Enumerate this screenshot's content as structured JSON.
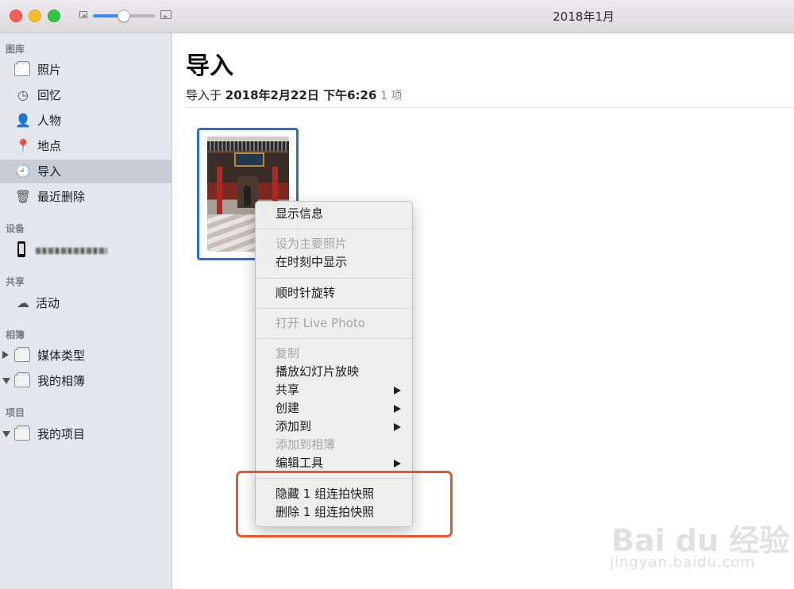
{
  "window": {
    "title": "2018年1月"
  },
  "sidebar": {
    "sections": {
      "library": "图库",
      "devices": "设备",
      "shared": "共享",
      "albums": "相簿",
      "projects": "项目"
    },
    "library_items": [
      {
        "label": "照片",
        "icon": "photos-icon"
      },
      {
        "label": "回忆",
        "icon": "memories-icon"
      },
      {
        "label": "人物",
        "icon": "people-icon"
      },
      {
        "label": "地点",
        "icon": "places-icon"
      },
      {
        "label": "导入",
        "icon": "import-icon",
        "selected": true
      },
      {
        "label": "最近删除",
        "icon": "trash-icon"
      }
    ],
    "shared_items": [
      {
        "label": "活动",
        "icon": "cloud-icon"
      }
    ],
    "album_items": [
      {
        "label": "媒体类型",
        "expanded": false
      },
      {
        "label": "我的相簿",
        "expanded": true
      }
    ],
    "project_items": [
      {
        "label": "我的项目",
        "expanded": true
      }
    ]
  },
  "main": {
    "title": "导入",
    "subtitle_prefix": "导入于",
    "subtitle_date": "2018年2月22日 下午6:26",
    "subtitle_count": "1 项"
  },
  "context_menu": {
    "items": [
      {
        "label": "显示信息",
        "enabled": true
      },
      {
        "label": "设为主要照片",
        "enabled": false
      },
      {
        "label": "在时刻中显示",
        "enabled": true
      },
      {
        "label": "顺时针旋转",
        "enabled": true
      },
      {
        "label": "打开 Live Photo",
        "enabled": false
      },
      {
        "label": "复制",
        "enabled": false
      },
      {
        "label": "播放幻灯片放映",
        "enabled": true
      },
      {
        "label": "共享",
        "enabled": true,
        "submenu": true
      },
      {
        "label": "创建",
        "enabled": true,
        "submenu": true
      },
      {
        "label": "添加到",
        "enabled": true,
        "submenu": true
      },
      {
        "label": "添加到相簿",
        "enabled": false
      },
      {
        "label": "编辑工具",
        "enabled": true,
        "submenu": true
      },
      {
        "label": "隐藏 1 组连拍快照",
        "enabled": true
      },
      {
        "label": "删除 1 组连拍快照",
        "enabled": true
      }
    ]
  },
  "watermark": {
    "brand": "Bai du 经验",
    "url": "jingyan.baidu.com"
  },
  "colors": {
    "accent": "#2b6fd4",
    "highlight": "#e5592f",
    "sidebar_bg": "#e4e8ee"
  },
  "zoom_slider_level": 0.5
}
